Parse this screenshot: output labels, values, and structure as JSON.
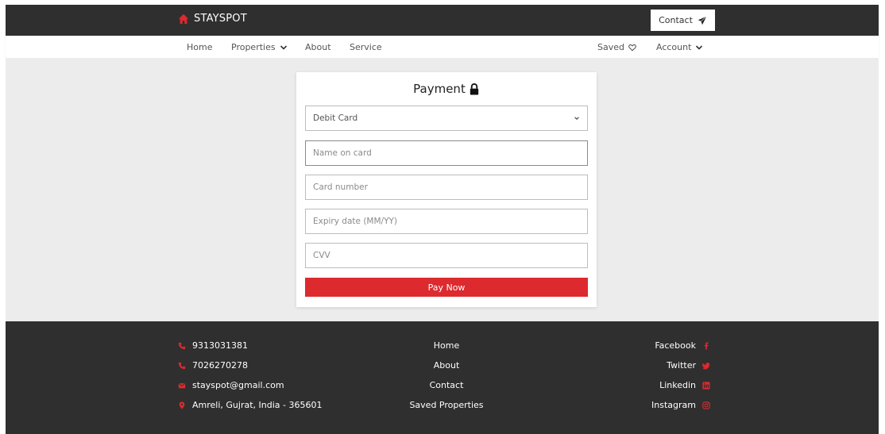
{
  "header": {
    "brand": "STAYSPOT",
    "contact_label": "Contact"
  },
  "nav": {
    "home": "Home",
    "properties": "Properties",
    "about": "About",
    "service": "Service",
    "saved": "Saved",
    "account": "Account"
  },
  "payment": {
    "title": "Payment",
    "method_selected": "Debit Card",
    "name_placeholder": "Name on card",
    "card_placeholder": "Card number",
    "expiry_placeholder": "Expiry date (MM/YY)",
    "cvv_placeholder": "CVV",
    "pay_label": "Pay Now"
  },
  "footer": {
    "phone1": "9313031381",
    "phone2": "7026270278",
    "email": "stayspot@gmail.com",
    "address": "Amreli, Gujrat, India - 365601",
    "links": {
      "home": "Home",
      "about": "About",
      "contact": "Contact",
      "saved": "Saved Properties"
    },
    "social": {
      "facebook": "Facebook",
      "twitter": "Twitter",
      "linkedin": "Linkedin",
      "instagram": "Instagram"
    }
  },
  "colors": {
    "accent": "#dc2a2f",
    "dark": "#2f2f2f",
    "background": "#ececec"
  }
}
